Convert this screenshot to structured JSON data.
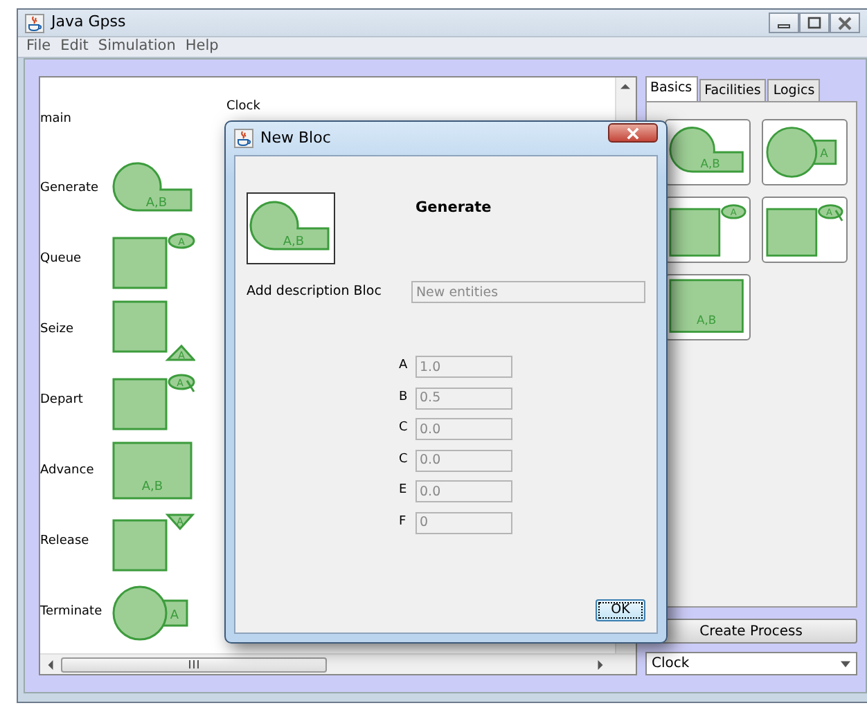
{
  "window": {
    "title": "Java Gpss"
  },
  "menu": [
    "File",
    "Edit",
    "Simulation",
    "Help"
  ],
  "canvas": {
    "process_label": "main",
    "clock_label": "Clock",
    "blocks": [
      {
        "name": "Generate",
        "kind": "generate",
        "label": "A,B"
      },
      {
        "name": "Queue",
        "kind": "queue",
        "label": "A"
      },
      {
        "name": "Seize",
        "kind": "seize",
        "label": "A"
      },
      {
        "name": "Depart",
        "kind": "depart",
        "label": "A"
      },
      {
        "name": "Advance",
        "kind": "advance",
        "label": "A,B"
      },
      {
        "name": "Release",
        "kind": "release",
        "label": "A"
      },
      {
        "name": "Terminate",
        "kind": "terminate",
        "label": "A"
      }
    ]
  },
  "palette": {
    "tabs": [
      {
        "label": "Basics",
        "selected": true
      },
      {
        "label": "Facilities",
        "selected": false
      },
      {
        "label": "Logics",
        "selected": false
      }
    ],
    "items": [
      {
        "kind": "generate",
        "label": "A,B"
      },
      {
        "kind": "terminate",
        "label": "A"
      },
      {
        "kind": "queue",
        "label": "A"
      },
      {
        "kind": "depart",
        "label": "A"
      },
      {
        "kind": "advance",
        "label": "A,B"
      }
    ]
  },
  "create_button": "Create Process",
  "process_select": {
    "value": "Clock"
  },
  "dialog": {
    "title": "New Bloc",
    "preview": {
      "kind": "generate",
      "label": "A,B"
    },
    "heading": "Generate",
    "description": {
      "label": "Add description Bloc",
      "value": "New entities",
      "disabled": true
    },
    "params": [
      {
        "name": "A",
        "value": "1.0",
        "disabled": true
      },
      {
        "name": "B",
        "value": "0.5",
        "disabled": true
      },
      {
        "name": "C",
        "value": "0.0",
        "disabled": true
      },
      {
        "name": "C",
        "value": "0.0",
        "disabled": true
      },
      {
        "name": "E",
        "value": "0.0",
        "disabled": true
      },
      {
        "name": "F",
        "value": "0",
        "disabled": true
      }
    ],
    "ok_button": "OK"
  }
}
